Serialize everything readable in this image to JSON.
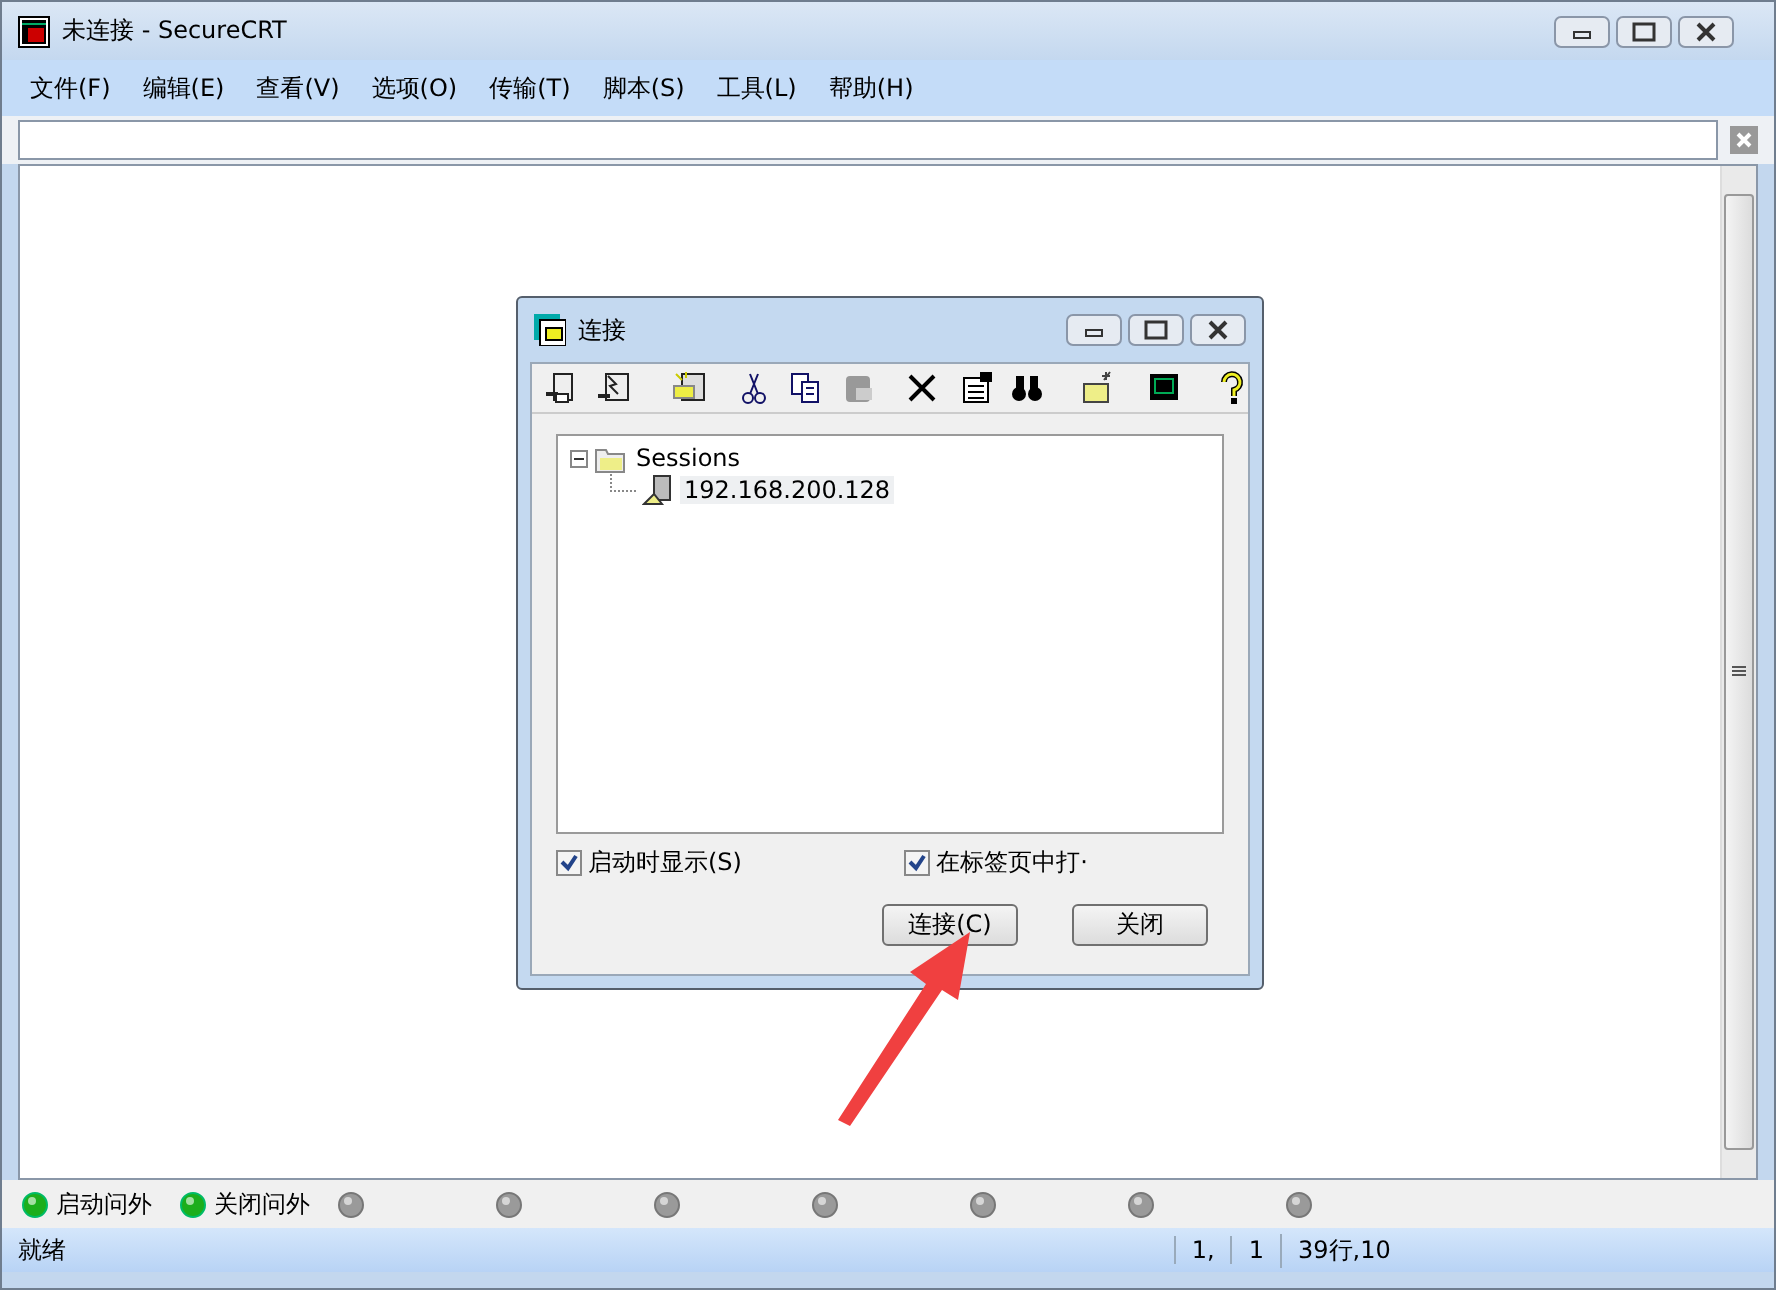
{
  "window": {
    "title": "未连接 - SecureCRT"
  },
  "menu": [
    "文件(F)",
    "编辑(E)",
    "查看(V)",
    "选项(O)",
    "传输(T)",
    "脚本(S)",
    "工具(L)",
    "帮助(H)"
  ],
  "dialog": {
    "title": "连接",
    "tree": [
      {
        "label": "Sessions",
        "kind": "folder",
        "expanded": true,
        "selected": false,
        "children": [
          {
            "label": "192.168.200.128",
            "kind": "session",
            "selected": true
          }
        ]
      }
    ],
    "checkboxes": [
      {
        "label": "启动时显示(S)",
        "checked": true
      },
      {
        "label": "在标签页中打·",
        "checked": true
      }
    ],
    "buttons": [
      "连接(C)",
      "关闭"
    ]
  },
  "button_bar": [
    {
      "label": "启动问外",
      "on": true
    },
    {
      "label": "关闭问外",
      "on": true
    },
    {
      "on": false
    },
    {
      "on": false
    },
    {
      "on": false
    },
    {
      "on": false
    },
    {
      "on": false
    },
    {
      "on": false
    },
    {
      "on": false
    }
  ],
  "status_bar": {
    "message": "就绪",
    "row": "1,",
    "col": "1",
    "size": "39行,10"
  }
}
